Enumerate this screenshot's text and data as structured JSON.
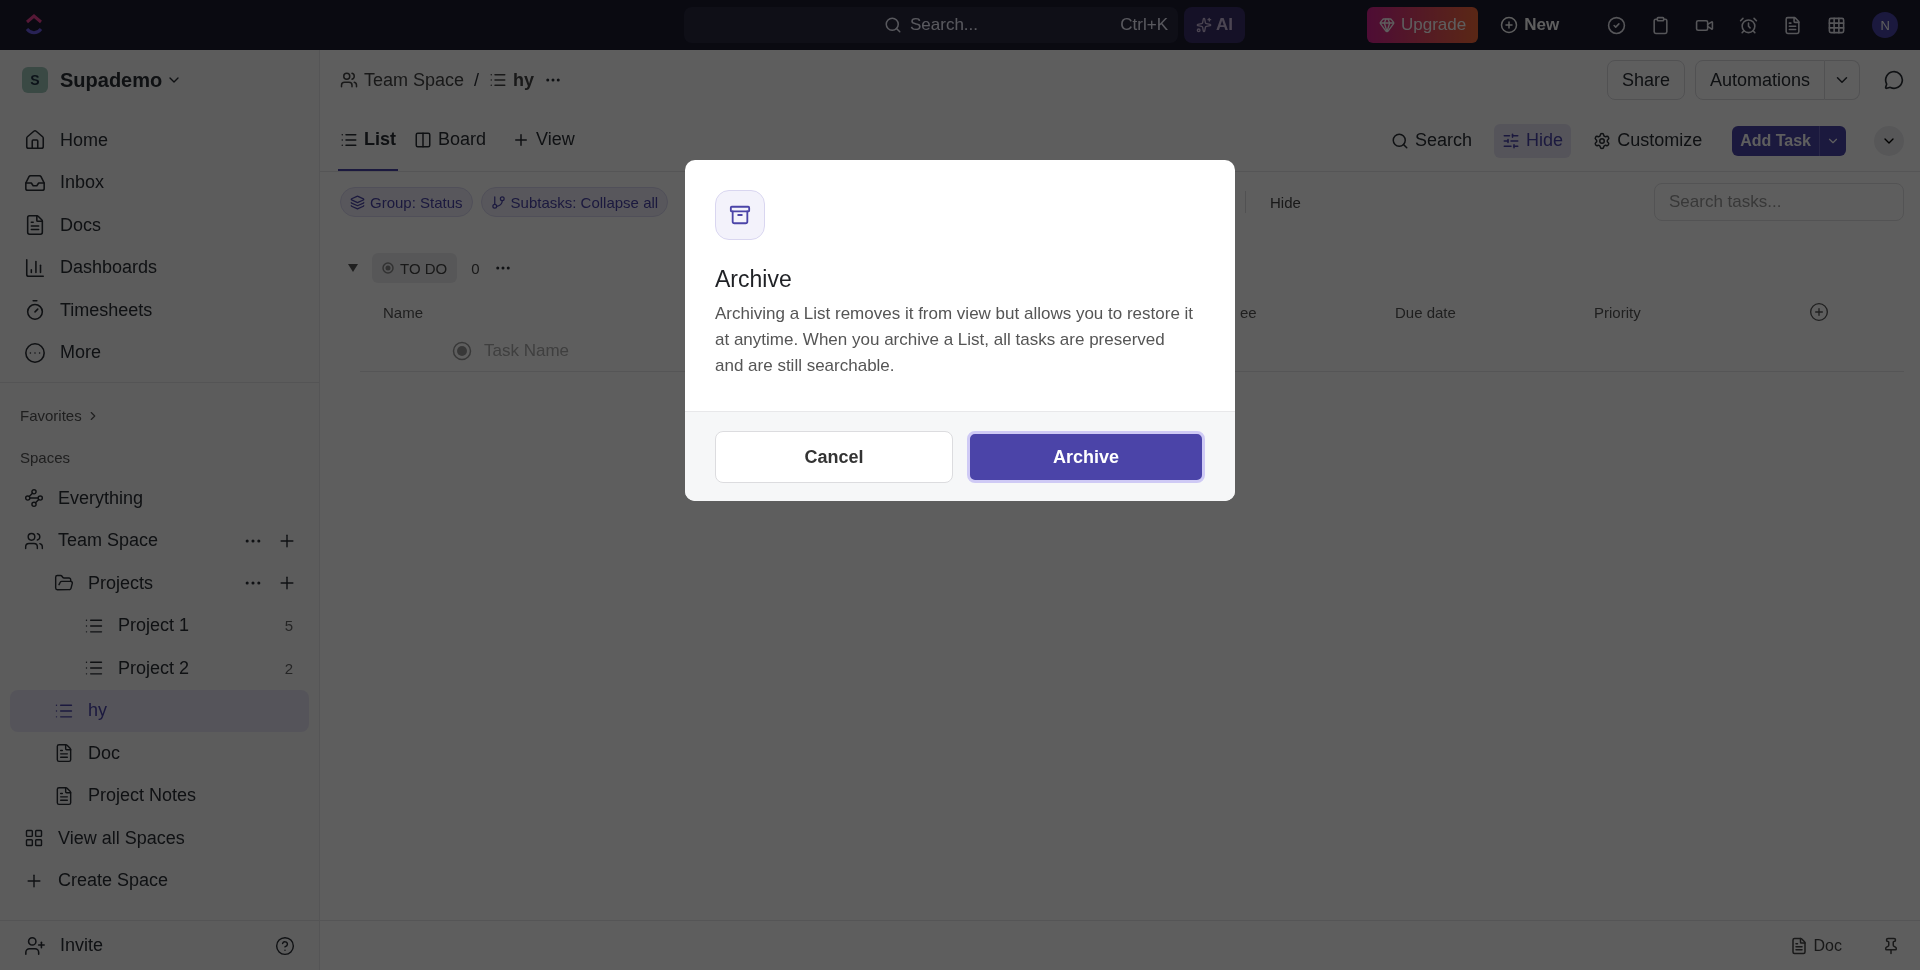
{
  "topbar": {
    "search": {
      "placeholder": "Search..."
    },
    "shortcut": "Ctrl+K",
    "ai": "AI",
    "upgrade": "Upgrade",
    "new": "New",
    "avatar": "N"
  },
  "sidebar": {
    "workspace": {
      "initial": "S",
      "name": "Supademo"
    },
    "nav": [
      {
        "label": "Home"
      },
      {
        "label": "Inbox"
      },
      {
        "label": "Docs"
      },
      {
        "label": "Dashboards"
      },
      {
        "label": "Timesheets"
      },
      {
        "label": "More"
      }
    ],
    "favorites": "Favorites",
    "spaces_label": "Spaces",
    "tree": [
      {
        "kind": "everything",
        "label": "Everything",
        "selected": false
      },
      {
        "kind": "space",
        "label": "Team Space",
        "selected": false,
        "children": [
          {
            "kind": "folder",
            "label": "Projects",
            "selected": false,
            "children": [
              {
                "kind": "list",
                "label": "Project 1",
                "count": "5",
                "selected": false
              },
              {
                "kind": "list",
                "label": "Project 2",
                "count": "2",
                "selected": false
              }
            ]
          },
          {
            "kind": "list",
            "label": "hy",
            "selected": true
          },
          {
            "kind": "doc",
            "label": "Doc",
            "selected": false
          },
          {
            "kind": "doc",
            "label": "Project Notes",
            "selected": false
          }
        ]
      },
      {
        "kind": "all",
        "label": "View all Spaces",
        "selected": false
      },
      {
        "kind": "create",
        "label": "Create Space",
        "selected": false
      }
    ],
    "invite": "Invite"
  },
  "main": {
    "breadcrumb": [
      {
        "label": "Team Space"
      },
      {
        "label": "hy"
      }
    ],
    "separator": "/",
    "share": "Share",
    "automations": "Automations",
    "views": [
      {
        "label": "List",
        "selected": true
      },
      {
        "label": "Board",
        "selected": false
      }
    ],
    "add_view": "View",
    "tools": [
      {
        "label": "Search",
        "active": false
      },
      {
        "label": "Hide",
        "active": true
      },
      {
        "label": "Customize",
        "active": false
      }
    ],
    "add_task": "Add Task",
    "chips": [
      {
        "label": "Group: Status"
      },
      {
        "label": "Subtasks: Collapse all"
      }
    ],
    "hide": "Hide",
    "search_tasks": {
      "placeholder": "Search tasks..."
    },
    "group": {
      "status": "TO DO",
      "count": "0"
    },
    "columns": [
      "Name",
      "ee",
      "Due date",
      "Priority"
    ],
    "task": {
      "placeholder": "Task Name"
    }
  },
  "status_bar": {
    "doc": "Doc"
  },
  "dialog": {
    "title": "Archive",
    "body": "Archiving a List removes it from view but allows you to restore it at anytime. When you archive a List, all tasks are preserved and are still searchable.",
    "cancel": "Cancel",
    "confirm": "Archive"
  }
}
